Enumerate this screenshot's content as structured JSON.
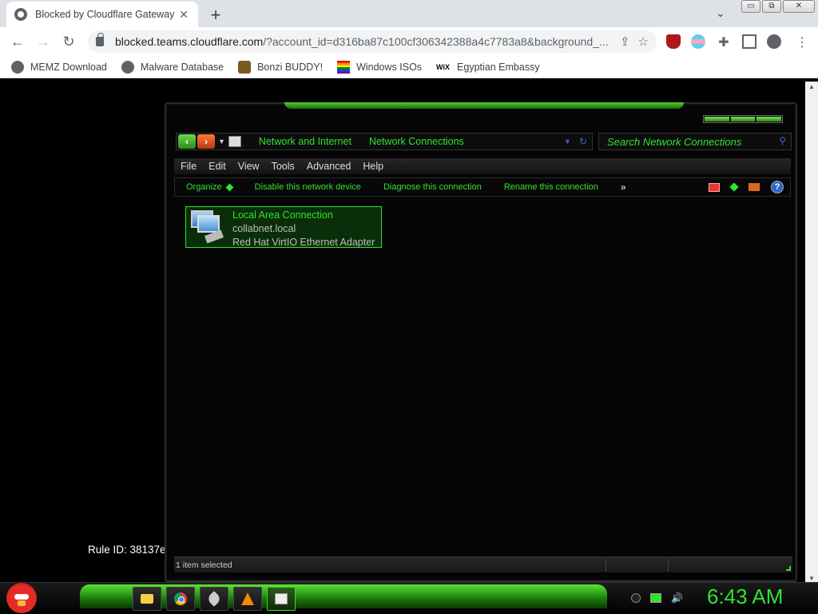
{
  "browser": {
    "tab_title": "Blocked by Cloudflare Gateway",
    "tab_close": "✕",
    "new_tab": "+",
    "tab_search": "⌄",
    "window_buttons": [
      "▭",
      "⧉",
      "✕"
    ],
    "url_host": "blocked.teams.cloudflare.com",
    "url_path": "/?account_id=d316ba87c100cf306342388a4c7783a8&background_...",
    "bookmarks": [
      {
        "label": "MEMZ Download",
        "icon": "globe-icon"
      },
      {
        "label": "Malware Database",
        "icon": "globe-icon"
      },
      {
        "label": "Bonzi BUDDY!",
        "icon": "bonzi-icon"
      },
      {
        "label": "Windows ISOs",
        "icon": "windows-flag-icon"
      },
      {
        "label": "Egyptian Embassy",
        "icon": "wix-icon"
      }
    ]
  },
  "page": {
    "rule_id": "Rule ID: 38137e"
  },
  "explorer": {
    "breadcrumbs": [
      "Network and Internet",
      "Network Connections"
    ],
    "search_placeholder": "Search Network Connections",
    "menu": [
      "File",
      "Edit",
      "View",
      "Tools",
      "Advanced",
      "Help"
    ],
    "commands": [
      "Organize",
      "Disable this network device",
      "Diagnose this connection",
      "Rename this connection"
    ],
    "more": "»",
    "help": "?",
    "item": {
      "name": "Local Area Connection",
      "network": "collabnet.local",
      "adapter": "Red Hat VirtIO Ethernet Adapter"
    },
    "status": "1 item selected"
  },
  "taskbar": {
    "apps": [
      "folder-icon",
      "chrome-icon",
      "rocket-icon",
      "vlc-icon",
      "paint-icon"
    ],
    "clock": "6:43 AM"
  },
  "colors": {
    "accent": "#2fe32f",
    "selection": "#0a2e0a"
  }
}
